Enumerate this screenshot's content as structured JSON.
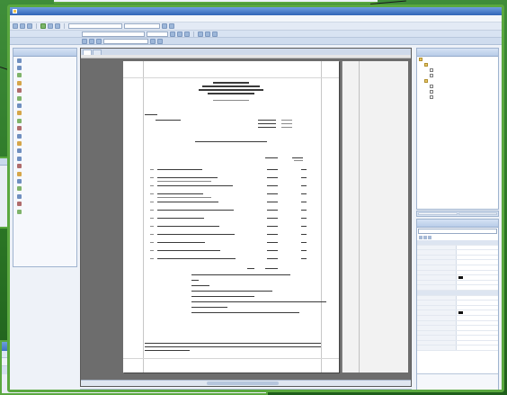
{
  "window": {
    "title": "",
    "menu": [
      "",
      "",
      "",
      ""
    ]
  },
  "toolbox": {
    "header": "",
    "items": [
      "",
      "",
      "",
      "",
      "",
      "",
      "",
      "",
      "",
      "",
      "",
      "",
      "",
      "",
      "",
      "",
      "",
      "",
      "",
      "",
      ""
    ]
  },
  "designer": {
    "tabs": [
      "",
      ""
    ],
    "report": {
      "header_lines": [
        "",
        "",
        "",
        "",
        ""
      ],
      "bill_to_label": "",
      "bill_to_value": "",
      "invoice_meta": [
        "",
        "",
        ""
      ],
      "section_heading": "",
      "columns": [
        "",
        ""
      ],
      "line_items": [
        {
          "desc": "",
          "qty": "",
          "amt": ""
        },
        {
          "desc": "",
          "qty": "",
          "amt": ""
        },
        {
          "desc": "",
          "qty": "",
          "amt": ""
        },
        {
          "desc": "",
          "qty": "",
          "amt": ""
        },
        {
          "desc": "",
          "qty": "",
          "amt": ""
        },
        {
          "desc": "",
          "qty": "",
          "amt": ""
        },
        {
          "desc": "",
          "qty": "",
          "amt": ""
        },
        {
          "desc": "",
          "qty": "",
          "amt": ""
        },
        {
          "desc": "",
          "qty": "",
          "amt": ""
        },
        {
          "desc": "",
          "qty": "",
          "amt": ""
        },
        {
          "desc": "",
          "qty": "",
          "amt": ""
        },
        {
          "desc": "",
          "qty": "",
          "amt": ""
        }
      ],
      "total_label": "",
      "total_value": "",
      "notes": [
        "",
        "",
        "",
        "",
        "",
        "",
        "",
        ""
      ],
      "footer": [
        "",
        "",
        ""
      ]
    }
  },
  "solution_explorer": {
    "header": "",
    "tree": [
      "",
      "",
      "",
      "",
      "",
      "",
      "",
      ""
    ]
  },
  "panel_tabs": [
    "",
    ""
  ],
  "properties": {
    "selected_object": "",
    "rows": [
      {
        "k": "",
        "v": "",
        "cat": true
      },
      {
        "k": "",
        "v": ""
      },
      {
        "k": "",
        "v": ""
      },
      {
        "k": "",
        "v": ""
      },
      {
        "k": "",
        "v": ""
      },
      {
        "k": "",
        "v": ""
      },
      {
        "k": "",
        "v": ""
      },
      {
        "k": "",
        "v": ""
      },
      {
        "k": "",
        "v": ""
      },
      {
        "k": "",
        "v": ""
      },
      {
        "k": "",
        "v": "",
        "cat": true
      },
      {
        "k": "",
        "v": ""
      },
      {
        "k": "",
        "v": ""
      },
      {
        "k": "",
        "v": ""
      },
      {
        "k": "",
        "v": ""
      },
      {
        "k": "",
        "v": ""
      },
      {
        "k": "",
        "v": ""
      },
      {
        "k": "",
        "v": ""
      },
      {
        "k": "",
        "v": ""
      },
      {
        "k": "",
        "v": ""
      },
      {
        "k": "",
        "v": ""
      },
      {
        "k": "",
        "v": ""
      }
    ],
    "description_title": "",
    "description_text": ""
  },
  "colors": {
    "highlight_frame": "#5aa83f",
    "title_bar": "#2f64b8",
    "paper": "#ffffff",
    "canvas": "#6d6d6d"
  }
}
